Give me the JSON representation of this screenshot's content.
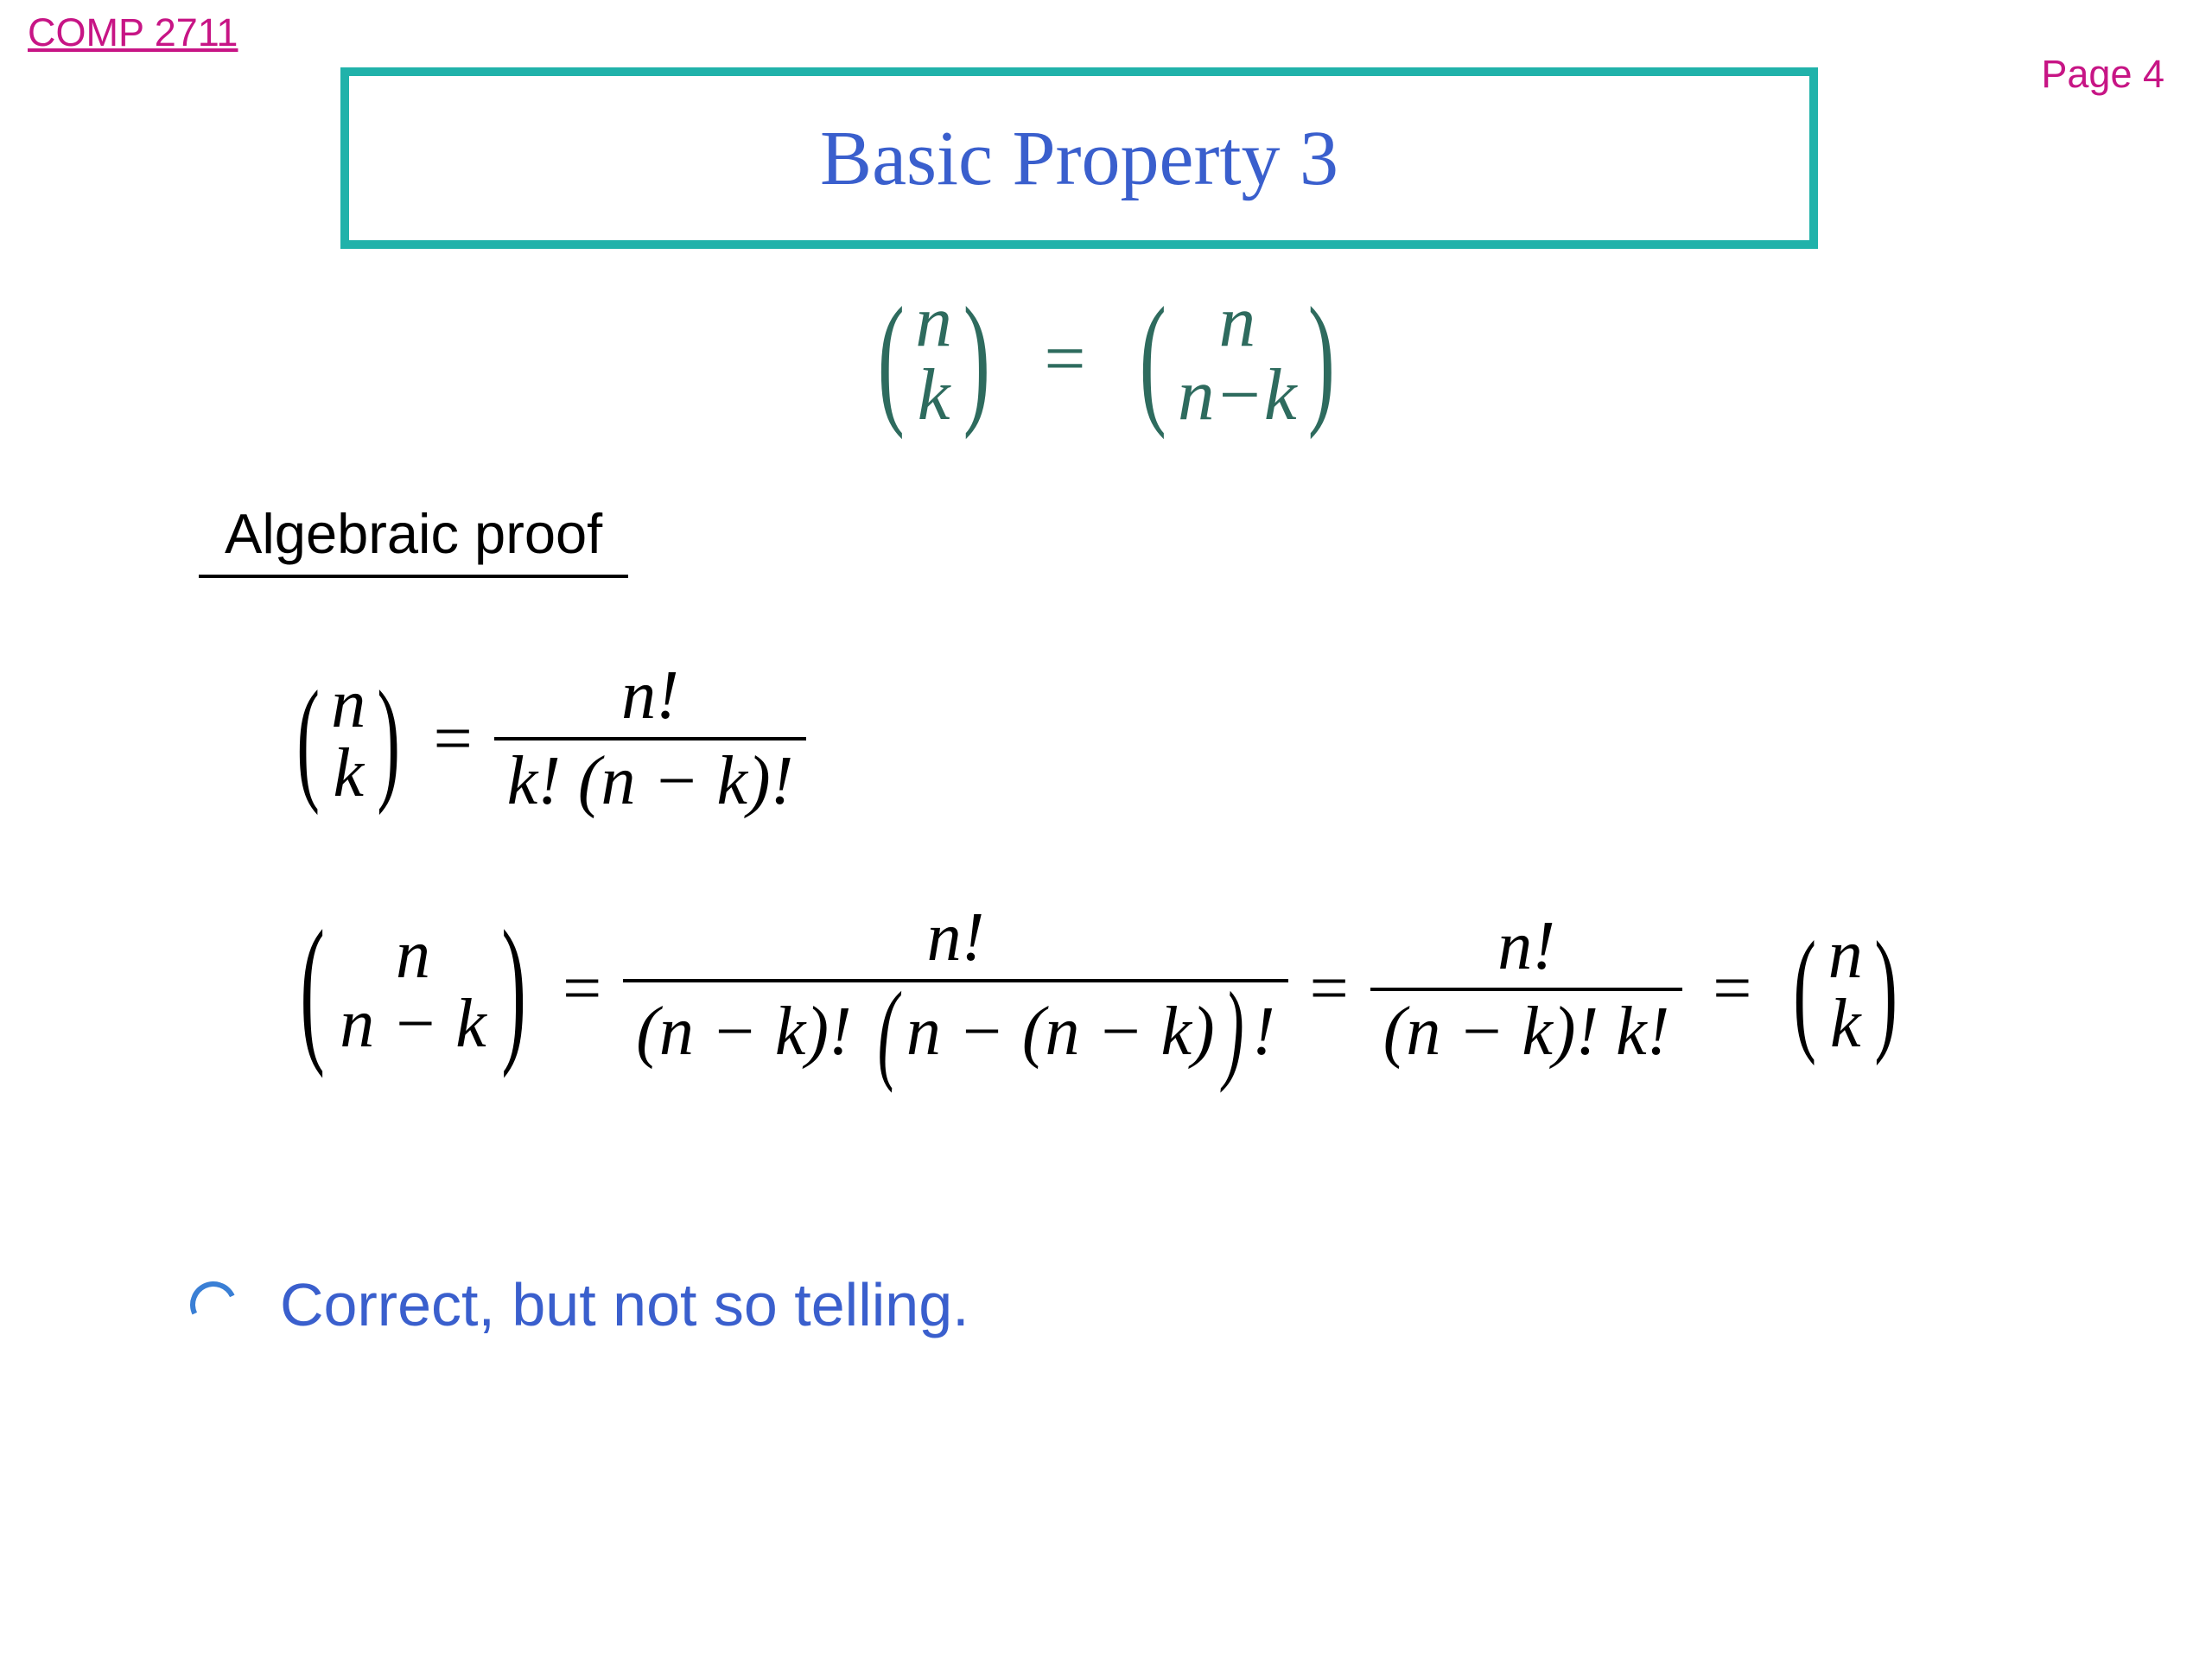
{
  "header": {
    "course_code": "COMP 2711",
    "page_label": "Page 4"
  },
  "title": "Basic Property 3",
  "main_equation": {
    "left_top": "n",
    "left_bottom": "k",
    "right_top": "n",
    "right_bottom": "n−k",
    "eq": "="
  },
  "subheader": "Algebraic proof",
  "proof_line1": {
    "binom_top": "n",
    "binom_bottom": "k",
    "eq": "=",
    "frac_num": "n!",
    "frac_den": "k! (n − k)!"
  },
  "proof_line2": {
    "binom_top": "n",
    "binom_bottom": "n − k",
    "eq1": "=",
    "frac1_num": "n!",
    "frac1_den": "(n − k)! (n − (n − k))!",
    "eq2": "=",
    "frac2_num": "n!",
    "frac2_den": "(n − k)! k!",
    "eq3": "=",
    "binom2_top": "n",
    "binom2_bottom": "k"
  },
  "bullet": "Correct, but not so telling."
}
